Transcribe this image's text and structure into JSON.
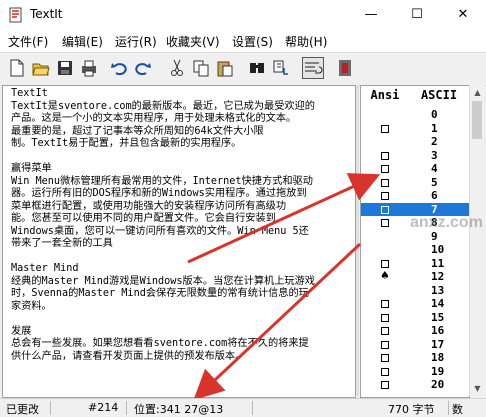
{
  "window": {
    "title": "TextIt",
    "minimize": "—",
    "maximize": "☐",
    "close": "✕"
  },
  "menu": [
    "文件(F)",
    "编辑(E)",
    "运行(R)",
    "收藏夹(V)",
    "设置(S)",
    "帮助(H)"
  ],
  "toolbar_icons": [
    "new-file-icon",
    "open-folder-icon",
    "save-icon",
    "print-icon",
    "undo-icon",
    "redo-icon",
    "cut-icon",
    "copy-icon",
    "paste-icon",
    "find-icon",
    "replace-icon",
    "word-wrap-icon",
    "exit-icon"
  ],
  "editor": {
    "lines": [
      "TextIt",
      "TextIt是sventore.com的最新版本。最近，它已成为最受欢迎的",
      "产品。这是一个小的文本实用程序，用于处理未格式化的文本。",
      "最重要的是，超过了记事本等众所周知的64k文件大小限",
      "制。TextIt易于配置，并且包含最新的实用程序。",
      "",
      "赢得菜单",
      "Win Menu微标管理所有最常用的文件，Internet快捷方式和驱动",
      "器。运行所有旧的DOS程序和新的Windows实用程序。通过拖放到",
      "菜单框进行配置，或使用功能强大的安装程序访问所有高级功",
      "能。您甚至可以使用不同的用户配置文件。它会自行安装到",
      "Windows桌面，您可以一键访问所有喜欢的文件。Win Menu 5还",
      "带来了一套全新的工具",
      "",
      "Master Mind",
      "经典的Master Mind游戏是Windows版本。当您在计算机上玩游戏",
      "时，Svenna的Master Mind会保存无限数量的常有统计信息的玩",
      "家资料。",
      "",
      "发展",
      "总会有一些发展。如果您想看看sventore.com将在不久的将来提",
      "供什么产品，请查看开发页面上提供的预发布版本。"
    ]
  },
  "charmap": {
    "headers": {
      "ansi": "Ansi",
      "ascii": "ASCII"
    },
    "rows": [
      {
        "num": "0",
        "glyph": ""
      },
      {
        "num": "1",
        "glyph": "box"
      },
      {
        "num": "2",
        "glyph": ""
      },
      {
        "num": "3",
        "glyph": "box"
      },
      {
        "num": "4",
        "glyph": "box"
      },
      {
        "num": "5",
        "glyph": "box"
      },
      {
        "num": "6",
        "glyph": "box"
      },
      {
        "num": "7",
        "glyph": "box"
      },
      {
        "num": "8",
        "glyph": "box"
      },
      {
        "num": "9",
        "glyph": ""
      },
      {
        "num": "10",
        "glyph": ""
      },
      {
        "num": "11",
        "glyph": "box"
      },
      {
        "num": "12",
        "glyph": "spade"
      },
      {
        "num": "13",
        "glyph": ""
      },
      {
        "num": "14",
        "glyph": "box"
      },
      {
        "num": "15",
        "glyph": "box"
      },
      {
        "num": "16",
        "glyph": "box"
      },
      {
        "num": "17",
        "glyph": "box"
      },
      {
        "num": "18",
        "glyph": "box"
      },
      {
        "num": "19",
        "glyph": "box"
      },
      {
        "num": "20",
        "glyph": "box"
      }
    ],
    "selected": "7"
  },
  "statusbar": {
    "modified": "已更改",
    "index": "#214",
    "position": "位置:341  27@13",
    "size": "770 字节",
    "extra": "数"
  },
  "watermark": "anxz.com",
  "colors": {
    "selection": "#1e78d7",
    "arrow": "#d9342b"
  }
}
